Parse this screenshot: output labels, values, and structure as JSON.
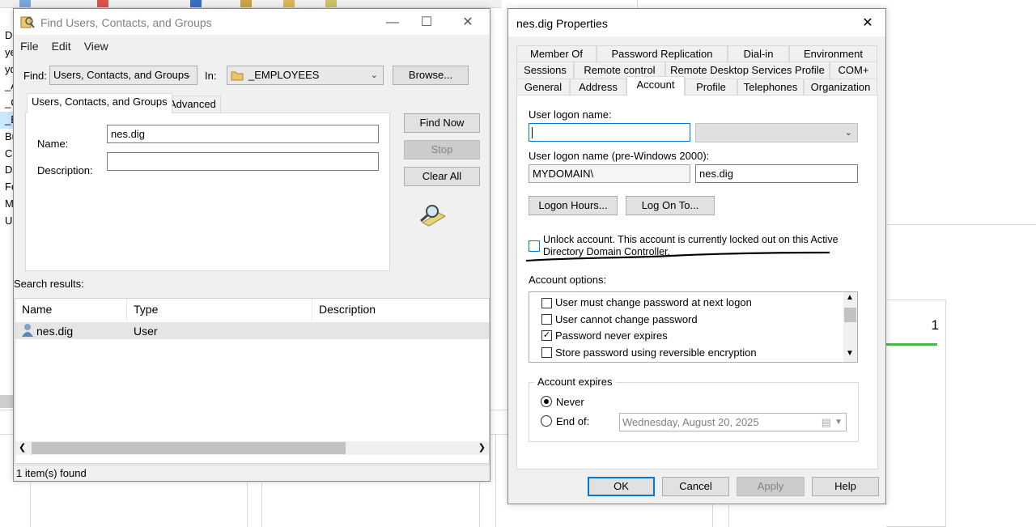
{
  "background": {
    "tree_items": [
      "Di",
      "yed",
      "ydo",
      "_A",
      "_C",
      "_E",
      "Bu",
      "C",
      "D",
      "Fo",
      "M",
      "U"
    ],
    "card_value": "1",
    "accent": "#4cb84c"
  },
  "find_dialog": {
    "title": "Find Users, Contacts, and Groups",
    "icon": "find-users-icon",
    "menu": [
      "File",
      "Edit",
      "View"
    ],
    "find_label": "Find:",
    "find_value": "Users, Contacts, and Groups",
    "in_label": "In:",
    "in_value": "_EMPLOYEES",
    "browse_label": "Browse...",
    "tabs": [
      "Users, Contacts, and Groups",
      "Advanced"
    ],
    "name_label": "Name:",
    "name_value": "nes.dig",
    "description_label": "Description:",
    "description_value": "",
    "find_now_label": "Find Now",
    "stop_label": "Stop",
    "clear_all_label": "Clear All",
    "search_results_label": "Search results:",
    "columns": [
      "Name",
      "Type",
      "Description"
    ],
    "results": [
      {
        "name": "nes.dig",
        "type": "User",
        "description": ""
      }
    ],
    "status": "1 item(s) found"
  },
  "props_dialog": {
    "title": "nes.dig Properties",
    "tabs_row1": [
      "Member Of",
      "Password Replication",
      "Dial-in",
      "Environment"
    ],
    "tabs_row2": [
      "Sessions",
      "Remote control",
      "Remote Desktop Services Profile",
      "COM+"
    ],
    "tabs_row3": [
      "General",
      "Address",
      "Account",
      "Profile",
      "Telephones",
      "Organization"
    ],
    "active_tab": "Account",
    "logon_name_label": "User logon name:",
    "logon_name_value": "",
    "upn_suffix_value": "",
    "pre2000_label": "User logon name (pre-Windows 2000):",
    "pre2000_domain": "MYDOMAIN\\",
    "pre2000_name": "nes.dig",
    "logon_hours_label": "Logon Hours...",
    "log_on_to_label": "Log On To...",
    "unlock_text_line1": "Unlock account. This account is currently locked out on this Active",
    "unlock_text_line2": "Directory Domain Controller.",
    "account_options_label": "Account options:",
    "account_options": [
      {
        "label": "User must change password at next logon",
        "checked": false
      },
      {
        "label": "User cannot change password",
        "checked": false
      },
      {
        "label": "Password never expires",
        "checked": true
      },
      {
        "label": "Store password using reversible encryption",
        "checked": false
      }
    ],
    "account_expires_label": "Account expires",
    "never_label": "Never",
    "end_of_label": "End of:",
    "expires_selected": "Never",
    "date_value": "Wednesday,    August    20, 2025",
    "ok_label": "OK",
    "cancel_label": "Cancel",
    "apply_label": "Apply",
    "help_label": "Help"
  }
}
